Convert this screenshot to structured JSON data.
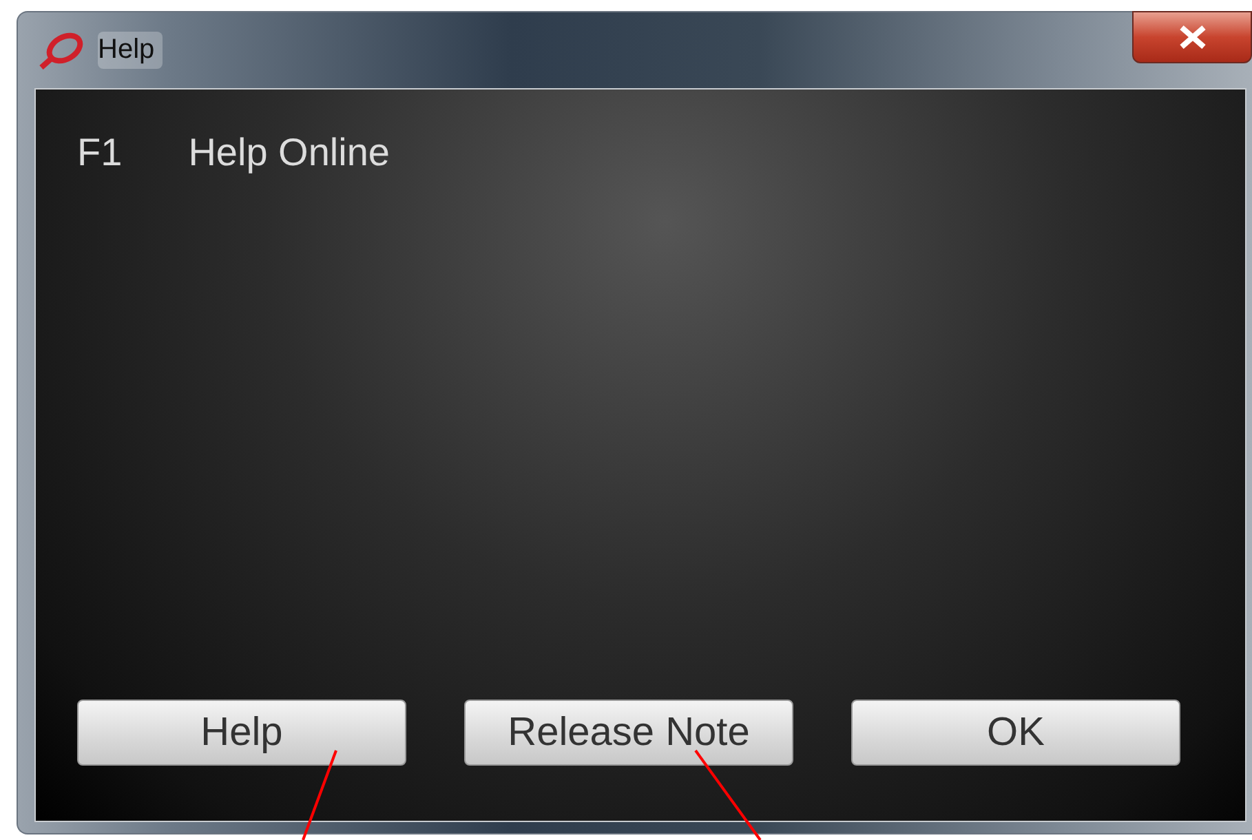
{
  "window": {
    "title": "Help"
  },
  "shortcuts": [
    {
      "key": "F1",
      "label": "Help Online"
    }
  ],
  "buttons": [
    "Help",
    "Release Note",
    "OK"
  ]
}
